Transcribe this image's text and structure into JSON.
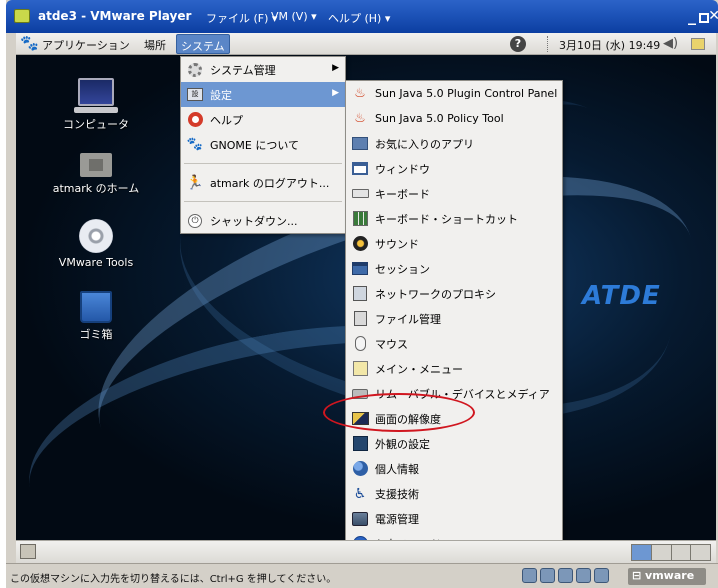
{
  "window": {
    "title": "atde3 - VMware Player",
    "menus": [
      "ファイル (F) ▾",
      "VM (V) ▾",
      "ヘルプ (H) ▾"
    ],
    "minimize": "_",
    "close": "✕"
  },
  "panel": {
    "applications": "アプリケーション",
    "places": "場所",
    "system": "システム",
    "help_symbol": "?",
    "clock": "3月10日 (水) 19:49"
  },
  "desktop": {
    "icons": [
      {
        "label": "コンピュータ"
      },
      {
        "label": "atmark のホーム"
      },
      {
        "label": "VMware Tools"
      },
      {
        "label": "ゴミ箱"
      }
    ],
    "logo": "ATDE"
  },
  "system_menu": {
    "items": [
      {
        "label": "システム管理",
        "icon": "gear-icon"
      },
      {
        "label": "設定",
        "icon": "preferences-icon",
        "active": true
      },
      {
        "label": "ヘルプ",
        "icon": "help-lifebuoy-icon"
      },
      {
        "label": "GNOME について",
        "icon": "gnome-foot-icon"
      },
      {
        "label": "atmark のログアウト...",
        "icon": "logout-icon"
      },
      {
        "label": "シャットダウン...",
        "icon": "shutdown-icon"
      }
    ]
  },
  "settings_menu": {
    "items": [
      {
        "label": "Sun Java 5.0 Plugin Control Panel",
        "icon": "java-icon"
      },
      {
        "label": "Sun Java 5.0 Policy Tool",
        "icon": "java-icon"
      },
      {
        "label": "お気に入りのアプリ",
        "icon": "favorite-apps-icon"
      },
      {
        "label": "ウィンドウ",
        "icon": "window-icon"
      },
      {
        "label": "キーボード",
        "icon": "keyboard-icon"
      },
      {
        "label": "キーボード・ショートカット",
        "icon": "keyboard-shortcuts-icon"
      },
      {
        "label": "サウンド",
        "icon": "sound-icon"
      },
      {
        "label": "セッション",
        "icon": "session-icon"
      },
      {
        "label": "ネットワークのプロキシ",
        "icon": "network-proxy-icon"
      },
      {
        "label": "ファイル管理",
        "icon": "file-management-icon"
      },
      {
        "label": "マウス",
        "icon": "mouse-icon"
      },
      {
        "label": "メイン・メニュー",
        "icon": "main-menu-icon"
      },
      {
        "label": "リムーバブル・デバイスとメディア",
        "icon": "removable-media-icon"
      },
      {
        "label": "画面の解像度",
        "icon": "screen-resolution-icon",
        "highlighted": true
      },
      {
        "label": "外観の設定",
        "icon": "appearance-icon"
      },
      {
        "label": "個人情報",
        "icon": "personal-info-icon"
      },
      {
        "label": "支援技術",
        "icon": "accessibility-icon"
      },
      {
        "label": "電源管理",
        "icon": "power-management-icon"
      },
      {
        "label": "入力メソッド",
        "icon": "input-method-icon"
      }
    ]
  },
  "status_bar": {
    "text": "この仮想マシンに入力先を切り替えるには、Ctrl+G を押してください。",
    "vmware_logo": "vmware"
  },
  "colors": {
    "title_bar": "#1d53b8",
    "menu_highlight": "#6d97d2",
    "annotation_oval": "#d0161f"
  }
}
